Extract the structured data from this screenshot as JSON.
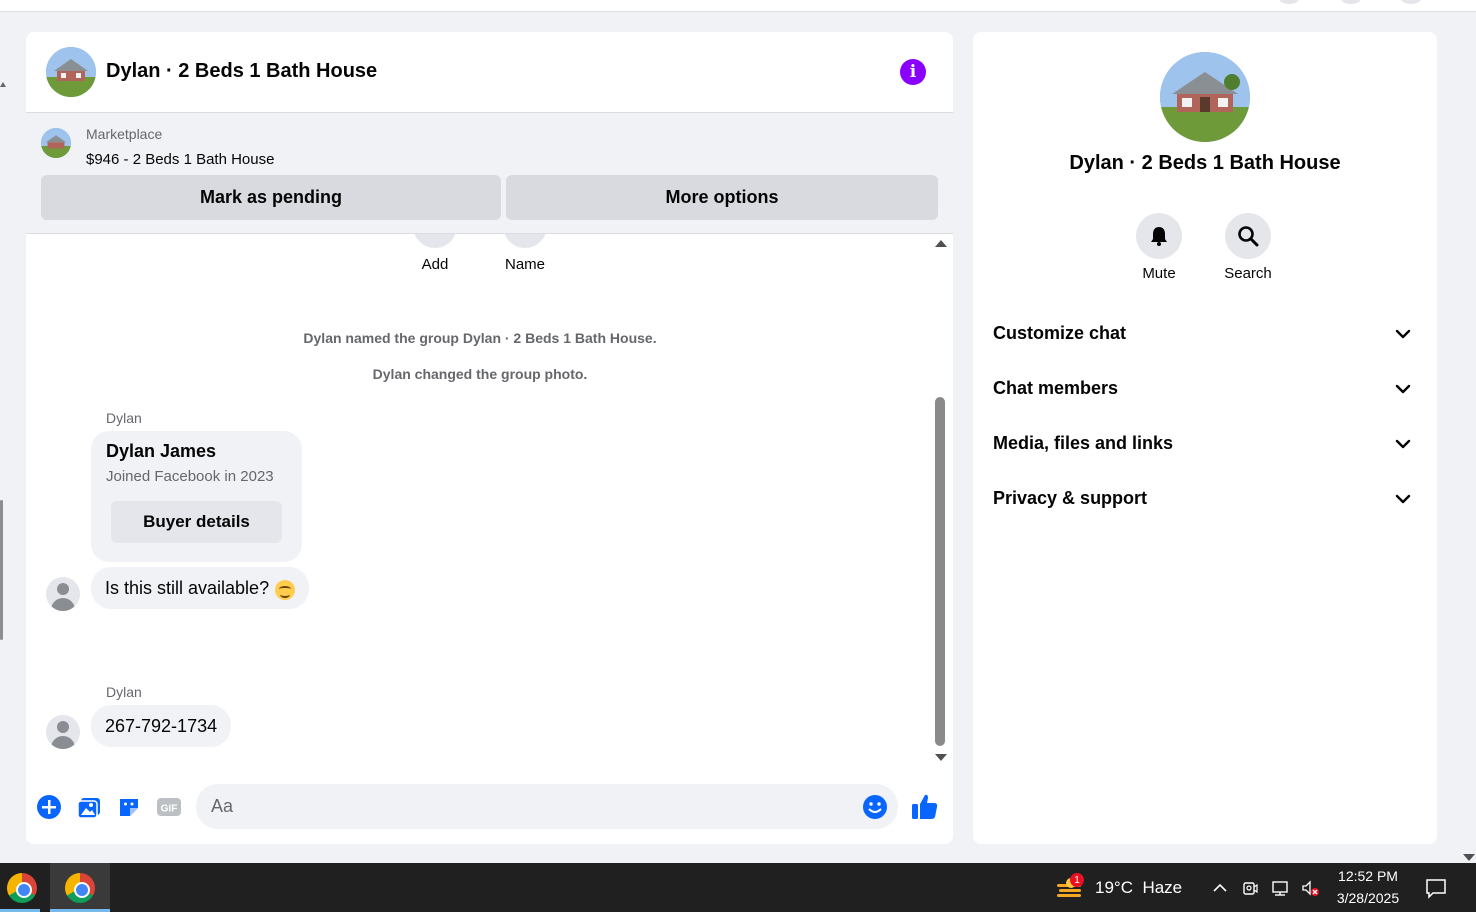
{
  "chat": {
    "title": "Dylan · 2 Beds 1 Bath House",
    "info_icon": "info-icon",
    "marketplace": {
      "label": "Marketplace",
      "price_title": "$946 - 2 Beds 1 Bath House",
      "mark_pending": "Mark as pending",
      "more_options": "More options"
    },
    "actions": [
      {
        "label": "Add"
      },
      {
        "label": "Name"
      }
    ],
    "system_messages": [
      "Dylan named the group Dylan · 2 Beds 1 Bath House.",
      "Dylan changed the group photo."
    ],
    "messages": [
      {
        "sender": "Dylan",
        "card": {
          "name": "Dylan James",
          "joined": "Joined Facebook in 2023",
          "button": "Buyer details"
        },
        "text": "Is this still available?",
        "emoji": "smiling-face-emoji"
      },
      {
        "sender": "Dylan",
        "text": "267-792-1734"
      }
    ],
    "composer": {
      "placeholder": "Aa",
      "icons": [
        "plus-circle-icon",
        "photo-icon",
        "sticker-icon",
        "gif-icon",
        "emoji-icon",
        "thumbs-up-icon"
      ]
    }
  },
  "details": {
    "title": "Dylan · 2 Beds 1 Bath House",
    "actions": [
      {
        "label": "Mute",
        "icon": "bell-icon"
      },
      {
        "label": "Search",
        "icon": "search-icon"
      }
    ],
    "sections": [
      {
        "label": "Customize chat"
      },
      {
        "label": "Chat members"
      },
      {
        "label": "Media, files and links"
      },
      {
        "label": "Privacy & support"
      }
    ]
  },
  "taskbar": {
    "weather": {
      "temp": "19°C",
      "condition": "Haze",
      "badge": "1"
    },
    "time": "12:52 PM",
    "date": "3/28/2025"
  },
  "colors": {
    "accent": "#0866ff",
    "info_purple": "#8a00ff",
    "bubble_bg": "#f0f2f5",
    "taskbar_bg": "#202020"
  }
}
